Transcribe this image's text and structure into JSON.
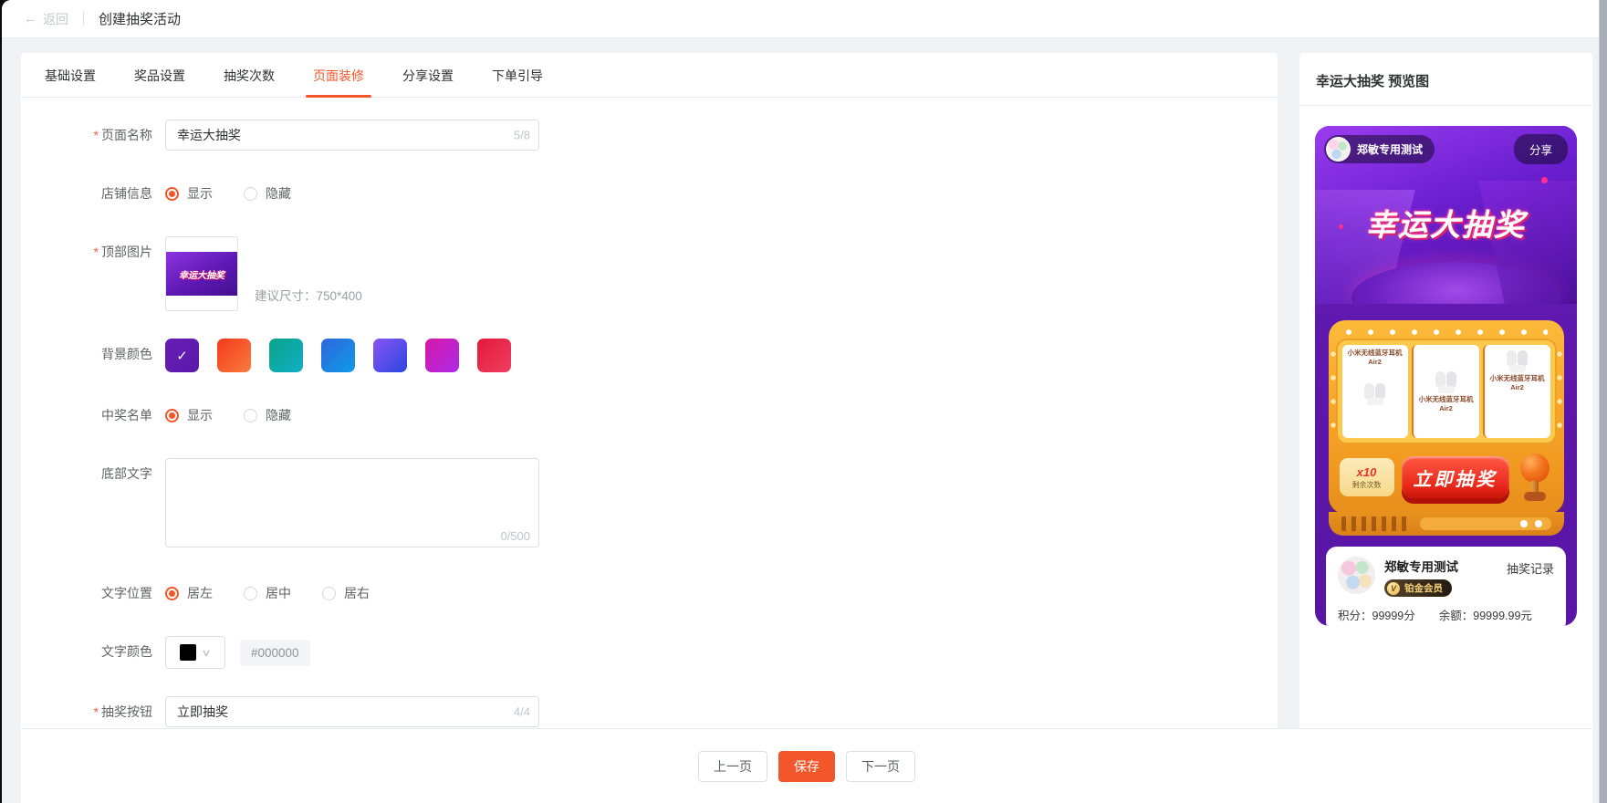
{
  "header": {
    "back_label": "返回",
    "title": "创建抽奖活动"
  },
  "tabs": [
    {
      "label": "基础设置",
      "active": false
    },
    {
      "label": "奖品设置",
      "active": false
    },
    {
      "label": "抽奖次数",
      "active": false
    },
    {
      "label": "页面装修",
      "active": true
    },
    {
      "label": "分享设置",
      "active": false
    },
    {
      "label": "下单引导",
      "active": false
    }
  ],
  "form": {
    "page_name": {
      "label": "页面名称",
      "required": true,
      "value": "幸运大抽奖",
      "counter": "5/8"
    },
    "shop_info": {
      "label": "店铺信息",
      "options": [
        "显示",
        "隐藏"
      ],
      "selected": "显示"
    },
    "top_image": {
      "label": "顶部图片",
      "required": true,
      "thumb_text": "幸运大抽奖",
      "hint": "建议尺寸：750*400"
    },
    "bg_color": {
      "label": "背景颜色",
      "selected_index": 0,
      "check_glyph": "✓",
      "swatches": [
        {
          "css": "linear-gradient(135deg,#671DB5,#5A19AA)"
        },
        {
          "css": "linear-gradient(135deg,#F4391C,#F97C3E)"
        },
        {
          "css": "linear-gradient(135deg,#0AA487,#11AFC6)"
        },
        {
          "css": "linear-gradient(135deg,#2F66DB,#0F9BE8)"
        },
        {
          "css": "linear-gradient(135deg,#8A55F2,#2B46E0)"
        },
        {
          "css": "linear-gradient(135deg,#D517A5,#AE2BEA)"
        },
        {
          "css": "linear-gradient(135deg,#E31937,#EF3E63)"
        }
      ]
    },
    "winner_list": {
      "label": "中奖名单",
      "options": [
        "显示",
        "隐藏"
      ],
      "selected": "显示"
    },
    "bottom_text": {
      "label": "底部文字",
      "value": "",
      "counter": "0/500"
    },
    "text_align": {
      "label": "文字位置",
      "options": [
        "居左",
        "居中",
        "居右"
      ],
      "selected": "居左"
    },
    "text_color": {
      "label": "文字颜色",
      "swatch": "#000000",
      "hex": "#000000",
      "chevron": "∨"
    },
    "draw_button": {
      "label": "抽奖按钮",
      "required": true,
      "value": "立即抽奖",
      "counter": "4/4"
    }
  },
  "footer": {
    "prev": "上一页",
    "save": "保存",
    "next": "下一页"
  },
  "preview": {
    "panel_title": "幸运大抽奖 预览图",
    "shop_name": "郑敏专用测试",
    "share_label": "分享",
    "banner_title": "幸运大抽奖",
    "prizes": [
      "小米无线蓝牙耳机Air2",
      "小米无线蓝牙耳机Air2",
      "小米无线蓝牙耳机Air2"
    ],
    "remaining": {
      "count": "x10",
      "label": "剩余次数"
    },
    "go_label": "立即抽奖",
    "user": {
      "name": "郑敏专用测试",
      "record_label": "抽奖记录",
      "vip_icon": "V",
      "vip_label": "铂金会员",
      "points": "积分：99999分",
      "balance": "余额：99999.99元"
    }
  },
  "colors": {
    "accent": "#F4562B",
    "preview_bg": "#5B16A8",
    "machine": "#F5A42A",
    "scrollbar": "#A9ADB8"
  }
}
